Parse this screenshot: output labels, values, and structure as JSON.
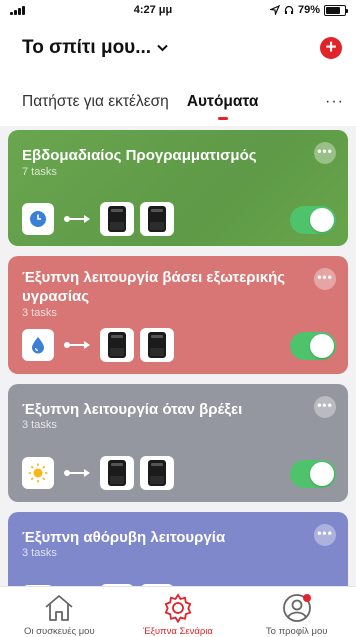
{
  "status_bar": {
    "time": "4:27 μμ",
    "battery": "79%",
    "battery_level": 0.79
  },
  "header": {
    "home_title": "Το σπίτι μου...",
    "add_icon": "plus-icon"
  },
  "tabs": {
    "tap_to_run": "Πατήστε για εκτέλεση",
    "automation": "Αυτόματα",
    "more": "···"
  },
  "cards": [
    {
      "title": "Εβδομαδιαίος Προγραμματισμός",
      "subtitle": "7 tasks",
      "trigger_icon": "clock-icon",
      "enabled": true,
      "color": "#67a54a"
    },
    {
      "title": "Έξυπνη λειτουργία βάσει εξωτερικής υγρασίας",
      "subtitle": "3 tasks",
      "trigger_icon": "water-drop-icon",
      "enabled": true,
      "color": "#d77675"
    },
    {
      "title": "Έξυπνη λειτουργία όταν βρέξει",
      "subtitle": "3 tasks",
      "trigger_icon": "sun-icon",
      "enabled": true,
      "color": "#9497a0"
    },
    {
      "title": "Έξυπνη αθόρυβη λειτουργία",
      "subtitle": "3 tasks",
      "trigger_icon": "clock-icon",
      "enabled": true,
      "color": "#8088cc"
    }
  ],
  "card_more": "•••",
  "bottom_nav": [
    {
      "label": "Οι συσκευές μου",
      "icon": "home-icon"
    },
    {
      "label": "Έξυπνα Σενάρια",
      "icon": "gear-icon",
      "active": true
    },
    {
      "label": "Το προφίλ μου",
      "icon": "profile-icon"
    }
  ],
  "colors": {
    "accent": "#e0242a",
    "toggle_on": "#4fc36b"
  }
}
